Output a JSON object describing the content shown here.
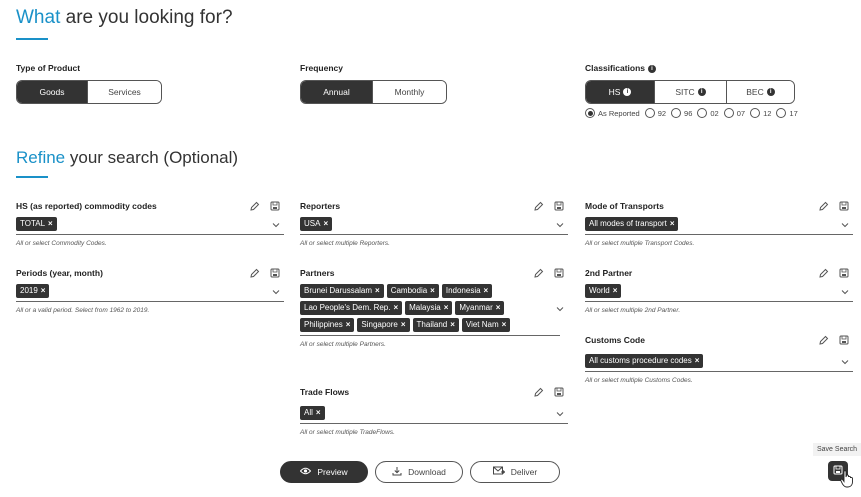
{
  "header": {
    "title_accent": "What",
    "title_rest": " are you looking for?"
  },
  "type_of_product": {
    "label": "Type of Product",
    "options": [
      "Goods",
      "Services"
    ],
    "selected": "Goods"
  },
  "frequency": {
    "label": "Frequency",
    "options": [
      "Annual",
      "Monthly"
    ],
    "selected": "Annual"
  },
  "classifications": {
    "label": "Classifications",
    "options": [
      "HS",
      "SITC",
      "BEC"
    ],
    "selected": "HS",
    "versions": [
      "As Reported",
      "92",
      "96",
      "02",
      "07",
      "12",
      "17"
    ],
    "selected_version": "As Reported"
  },
  "refine": {
    "title_accent": "Refine",
    "title_rest": " your search (Optional)"
  },
  "fields": {
    "hs_codes": {
      "label": "HS (as reported) commodity codes",
      "chips": [
        "TOTAL"
      ],
      "help": "All or select Commodity Codes."
    },
    "periods": {
      "label": "Periods (year, month)",
      "chips": [
        "2019"
      ],
      "help": "All or a valid period. Select from 1962 to 2019."
    },
    "reporters": {
      "label": "Reporters",
      "chips": [
        "USA"
      ],
      "help": "All or select multiple Reporters."
    },
    "partners": {
      "label": "Partners",
      "chips": [
        "Brunei Darussalam",
        "Cambodia",
        "Indonesia",
        "Lao People's Dem. Rep.",
        "Malaysia",
        "Myanmar",
        "Philippines",
        "Singapore",
        "Thailand",
        "Viet Nam"
      ],
      "help": "All or select multiple Partners."
    },
    "trade_flows": {
      "label": "Trade Flows",
      "chips": [
        "All"
      ],
      "help": "All or select multiple TradeFlows."
    },
    "transport": {
      "label": "Mode of Transports",
      "chips": [
        "All modes of transport"
      ],
      "help": "All or select multiple Transport Codes."
    },
    "partner2": {
      "label": "2nd Partner",
      "chips": [
        "World"
      ],
      "help": "All or select multiple 2nd Partner."
    },
    "customs": {
      "label": "Customs Code",
      "chips": [
        "All customs procedure codes"
      ],
      "help": "All or select multiple Customs Codes."
    }
  },
  "chip_remove": "×",
  "actions": {
    "preview": "Preview",
    "download": "Download",
    "deliver": "Deliver"
  },
  "save_search": {
    "tooltip": "Save Search"
  },
  "colors": {
    "accent": "#1a91c8",
    "dark": "#333333"
  }
}
